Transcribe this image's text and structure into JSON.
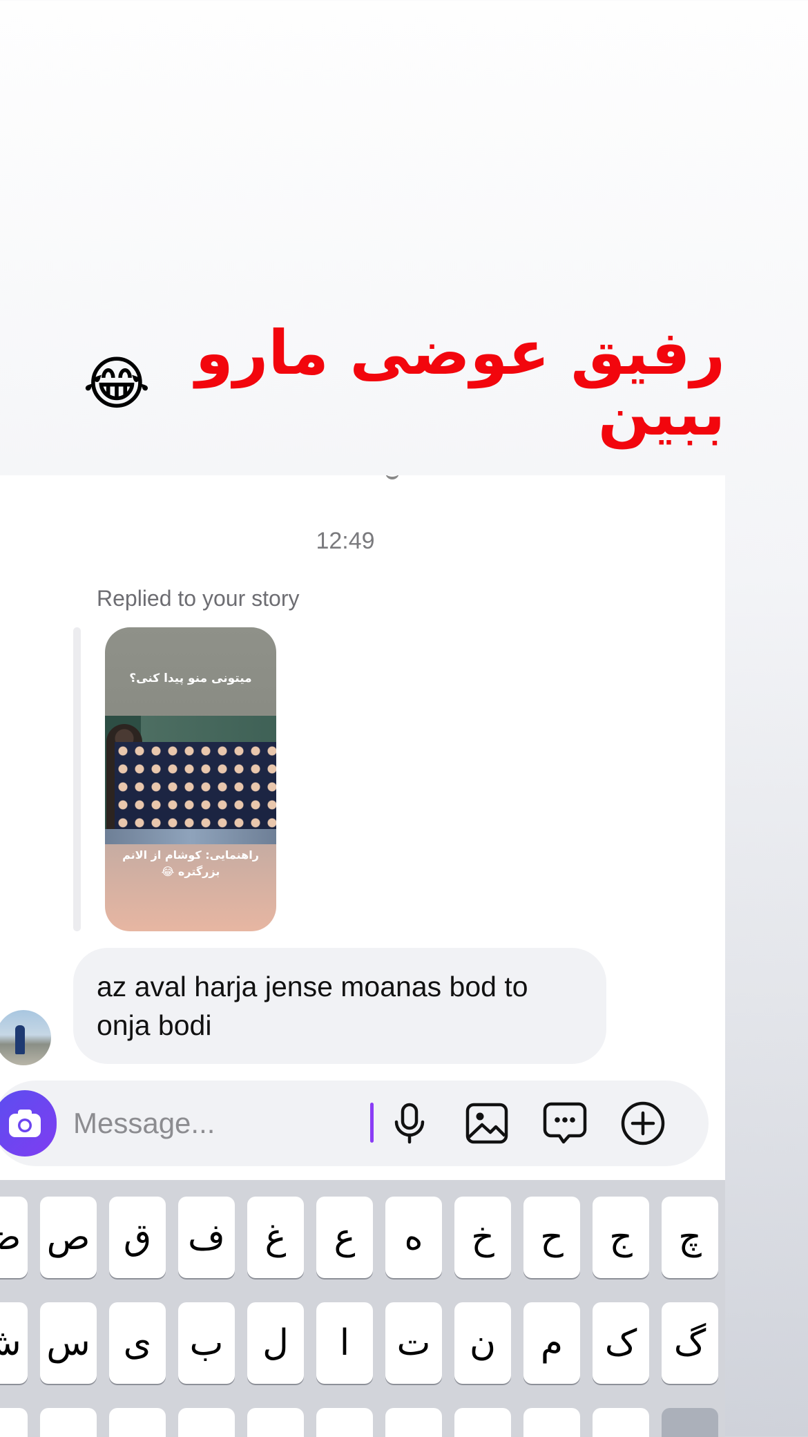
{
  "caption": {
    "text": "رفیق عوضی مارو ببین",
    "emoji": "😂"
  },
  "chat": {
    "timestamp": "12:49",
    "reply_label": "Replied to your story",
    "story": {
      "question": "میتونی منو پیدا کنی؟",
      "answer": "راهنمایی: کوشام از الانم بزرگتره 😂"
    },
    "message": "az aval harja jense moanas bod to onja bodi"
  },
  "composer": {
    "placeholder": "Message...",
    "icons": [
      "camera-icon",
      "microphone-icon",
      "image-icon",
      "sticker-icon",
      "plus-icon"
    ],
    "accent_color": "#7f3df1"
  },
  "keyboard": {
    "row1": [
      "ض",
      "ص",
      "ق",
      "ف",
      "غ",
      "ع",
      "ه",
      "خ",
      "ح",
      "ج",
      "چ"
    ],
    "row2": [
      "ش",
      "س",
      "ی",
      "ب",
      "ل",
      "ا",
      "ت",
      "ن",
      "م",
      "ک",
      "گ"
    ]
  }
}
